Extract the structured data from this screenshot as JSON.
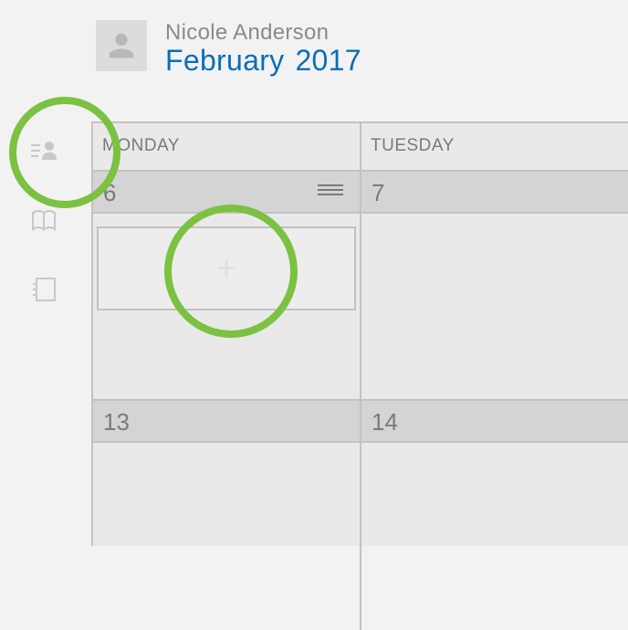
{
  "header": {
    "user_name": "Nicole Anderson",
    "month": "February",
    "year": "2017"
  },
  "calendar": {
    "day_headers": [
      "MONDAY",
      "TUESDAY"
    ],
    "week1": {
      "monday": "6",
      "tuesday": "7"
    },
    "week2": {
      "monday": "13",
      "tuesday": "14"
    }
  },
  "colors": {
    "highlight": "#7cc142",
    "accent": "#0a6eb4"
  }
}
